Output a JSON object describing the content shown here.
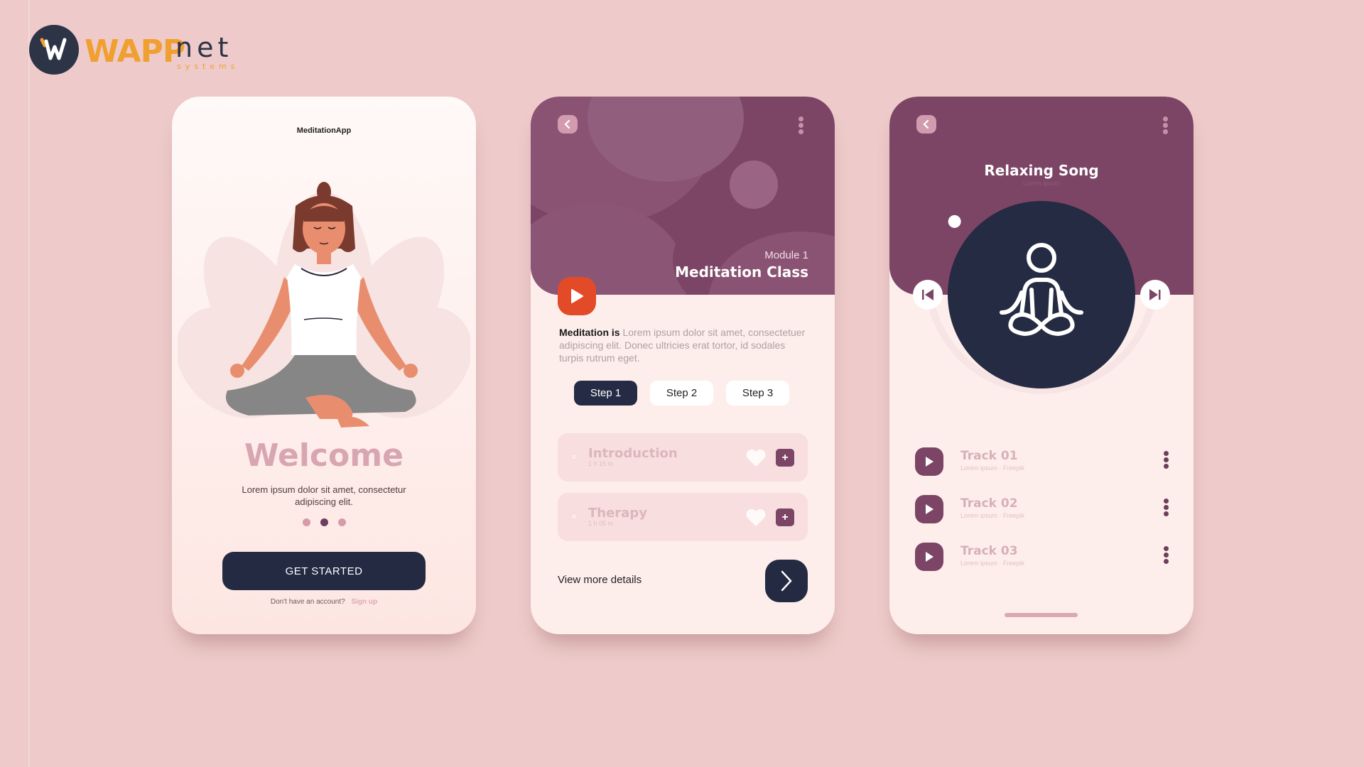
{
  "brand": {
    "logo_letter": "W",
    "name_primary": "WAPP",
    "name_secondary": "net",
    "tagline": "systems",
    "colors": {
      "orange": "#f0a030",
      "navy": "#2d3446"
    }
  },
  "theme": {
    "background": "#eecbca",
    "plum": "#7c4566",
    "navy": "#232a42",
    "accent_red": "#e24a28",
    "pink": "#d8a6b0"
  },
  "welcome_screen": {
    "app_title": "MeditationApp",
    "illustration": "woman-meditating-lotus-pose",
    "heading": "Welcome",
    "subtitle": "Lorem ipsum dolor sit amet, consectetur adipiscing elit.",
    "pager": {
      "count": 3,
      "active_index": 1
    },
    "cta_label": "GET STARTED",
    "signup_prompt": "Don't have an account?",
    "signup_link": "Sign up"
  },
  "class_screen": {
    "back_icon": "chevron-left-icon",
    "menu_icon": "kebab-menu-icon",
    "module_label": "Module 1",
    "title": "Meditation Class",
    "play_icon": "play-icon",
    "description_bold": "Meditation is",
    "description": " Lorem ipsum dolor sit amet, consectetuer adipiscing elit. Donec ultricies erat tortor, id sodales turpis rutrum eget.",
    "steps": [
      {
        "label": "Step 1",
        "active": true
      },
      {
        "label": "Step 2",
        "active": false
      },
      {
        "label": "Step 3",
        "active": false
      }
    ],
    "lessons": [
      {
        "title": "Introduction",
        "duration": "1 h 15 m"
      },
      {
        "title": "Therapy",
        "duration": "1 h 05 m"
      }
    ],
    "view_more_label": "View more details",
    "next_icon": "chevron-right-icon"
  },
  "player_screen": {
    "back_icon": "chevron-left-icon",
    "menu_icon": "kebab-menu-icon",
    "title": "Relaxing Song",
    "subtitle": "Lorem ipsum",
    "artwork_icon": "meditation-pose-icon",
    "prev_icon": "skip-previous-icon",
    "next_icon": "skip-next-icon",
    "progress_fraction": 0.2,
    "tracks": [
      {
        "title": "Track 01",
        "subtitle": "Lorem ipsum · Freepik"
      },
      {
        "title": "Track 02",
        "subtitle": "Lorem ipsum · Freepik"
      },
      {
        "title": "Track 03",
        "subtitle": "Lorem ipsum · Freepik"
      }
    ]
  }
}
